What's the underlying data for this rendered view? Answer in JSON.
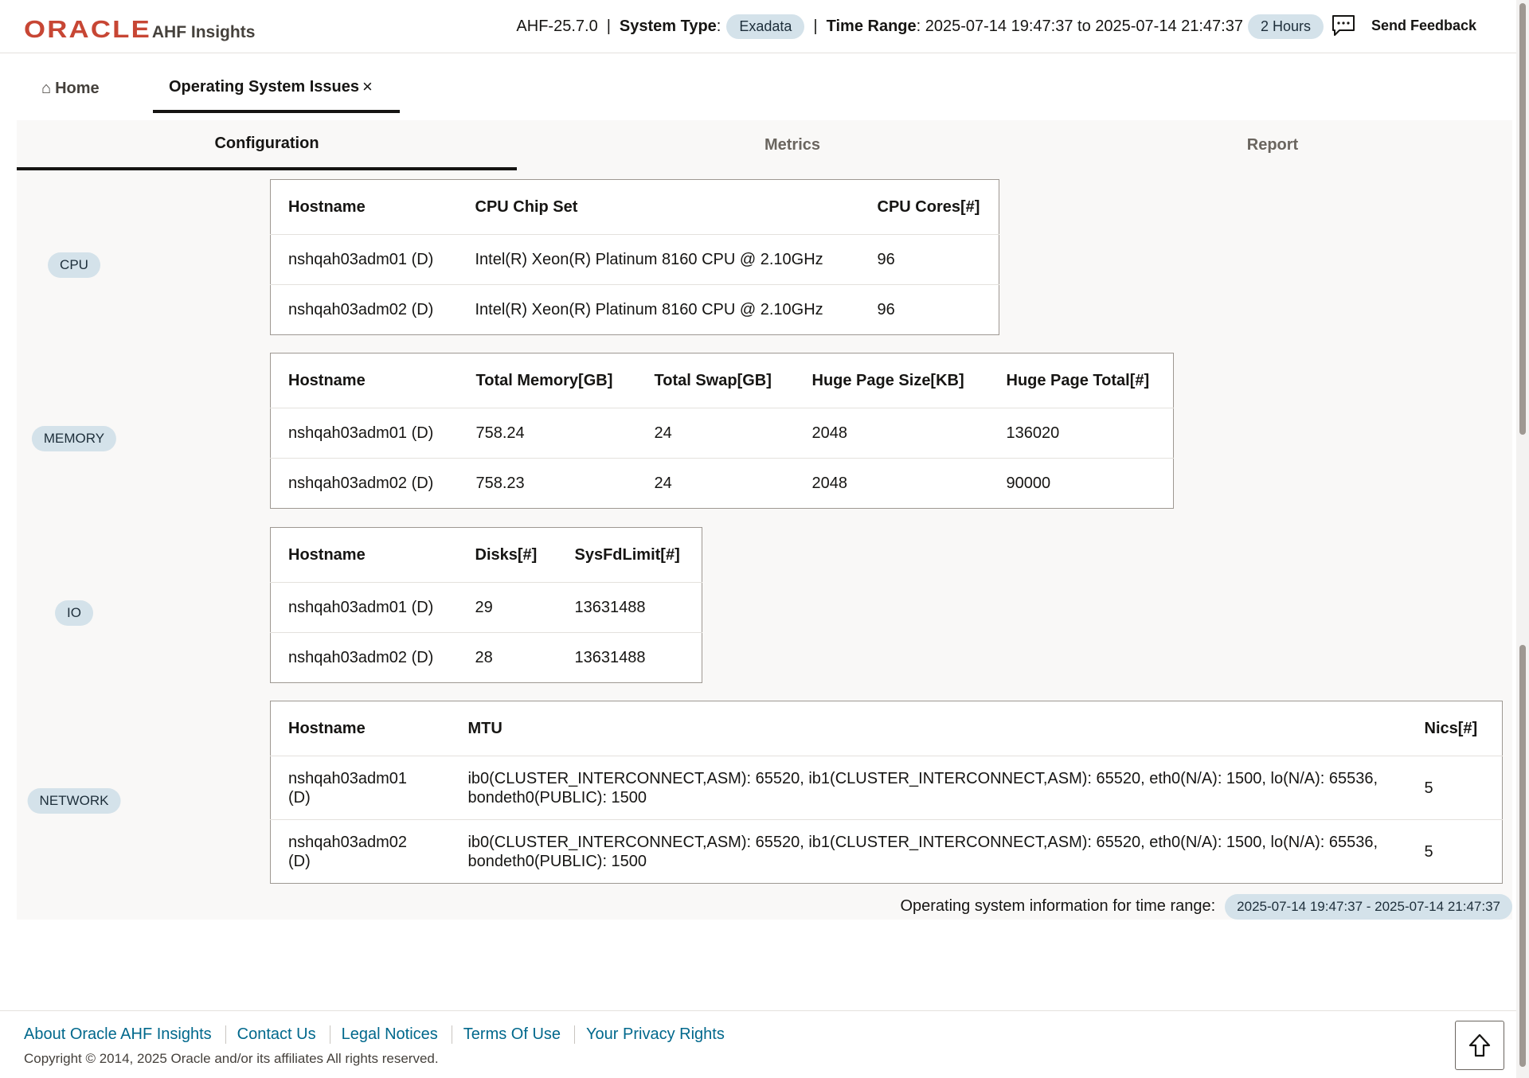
{
  "header": {
    "logo": "ORACLE",
    "app_name": "AHF Insights",
    "version": "AHF-25.7.0",
    "separator": "|",
    "system_type_label": "System Type",
    "system_type_value": "Exadata",
    "time_range_label": "Time Range",
    "time_range_value": "2025-07-14 19:47:37 to 2025-07-14 21:47:37",
    "duration": "2 Hours",
    "feedback_label": "Send Feedback"
  },
  "page_tabs": {
    "home": "Home",
    "active": "Operating System Issues",
    "close": "×"
  },
  "sub_tabs": [
    "Configuration",
    "Metrics",
    "Report"
  ],
  "sections": {
    "cpu": {
      "label": "CPU",
      "headers": [
        "Hostname",
        "CPU Chip Set",
        "CPU Cores[#]"
      ],
      "rows": [
        [
          "nshqah03adm01 (D)",
          "Intel(R) Xeon(R) Platinum 8160 CPU @ 2.10GHz",
          "96"
        ],
        [
          "nshqah03adm02 (D)",
          "Intel(R) Xeon(R) Platinum 8160 CPU @ 2.10GHz",
          "96"
        ]
      ]
    },
    "memory": {
      "label": "MEMORY",
      "headers": [
        "Hostname",
        "Total Memory[GB]",
        "Total Swap[GB]",
        "Huge Page Size[KB]",
        "Huge Page Total[#]"
      ],
      "rows": [
        [
          "nshqah03adm01 (D)",
          "758.24",
          "24",
          "2048",
          "136020"
        ],
        [
          "nshqah03adm02 (D)",
          "758.23",
          "24",
          "2048",
          "90000"
        ]
      ]
    },
    "io": {
      "label": "IO",
      "headers": [
        "Hostname",
        "Disks[#]",
        "SysFdLimit[#]"
      ],
      "rows": [
        [
          "nshqah03adm01 (D)",
          "29",
          "13631488"
        ],
        [
          "nshqah03adm02 (D)",
          "28",
          "13631488"
        ]
      ]
    },
    "network": {
      "label": "NETWORK",
      "headers": [
        "Hostname",
        "MTU",
        "Nics[#]"
      ],
      "rows": [
        [
          "nshqah03adm01 (D)",
          "ib0(CLUSTER_INTERCONNECT,ASM): 65520, ib1(CLUSTER_INTERCONNECT,ASM): 65520, eth0(N/A): 1500, lo(N/A): 65536, bondeth0(PUBLIC): 1500",
          "5"
        ],
        [
          "nshqah03adm02 (D)",
          "ib0(CLUSTER_INTERCONNECT,ASM): 65520, ib1(CLUSTER_INTERCONNECT,ASM): 65520, eth0(N/A): 1500, lo(N/A): 65536, bondeth0(PUBLIC): 1500",
          "5"
        ]
      ]
    }
  },
  "range_note": {
    "label": "Operating system information for time range:",
    "value": "2025-07-14 19:47:37 - 2025-07-14 21:47:37"
  },
  "footer": {
    "links": [
      "About Oracle AHF Insights",
      "Contact Us",
      "Legal Notices",
      "Terms Of Use",
      "Your Privacy Rights"
    ],
    "copyright": "Copyright © 2014, 2025 Oracle and/or its affiliates All rights reserved."
  },
  "icons": {
    "home": "home-icon",
    "close": "close-icon",
    "feedback": "chat-bubble-icon",
    "scroll_top": "arrow-up-icon"
  },
  "colors": {
    "brand": "#c74634",
    "pill_bg": "#d4e2ea",
    "link": "#00688c"
  }
}
